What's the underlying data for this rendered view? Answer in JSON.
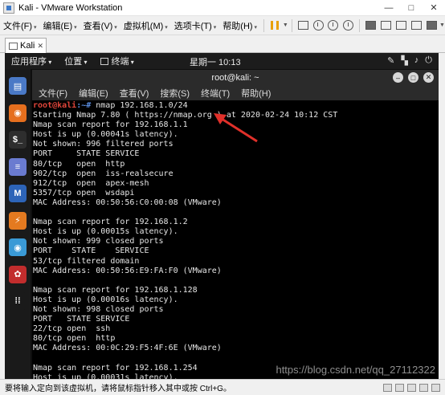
{
  "window": {
    "title": "Kali - VMware Workstation",
    "controls": [
      "—",
      "□",
      "✕"
    ]
  },
  "menubar": {
    "items": [
      "文件(F)",
      "编辑(E)",
      "查看(V)",
      "虚拟机(M)",
      "选项卡(T)",
      "帮助(H)"
    ]
  },
  "tab": {
    "label": "Kali",
    "close": "✕"
  },
  "gnome": {
    "apps_menu": "应用程序",
    "places_menu": "位置",
    "terminal_menu": "终端",
    "clock": "星期一 10:13",
    "tray": [
      "✎",
      "▚",
      "♪",
      "⏻"
    ]
  },
  "dock": {
    "icons": [
      {
        "name": "files-icon",
        "glyph": "▤",
        "color": "#4a79c6"
      },
      {
        "name": "firefox-icon",
        "glyph": "◉",
        "color": "#e66f1e"
      },
      {
        "name": "terminal-icon",
        "glyph": "$_",
        "color": "#2e2e2e"
      },
      {
        "name": "notes-icon",
        "glyph": "≡",
        "color": "#6a7bd0"
      },
      {
        "name": "metasploit-icon",
        "glyph": "M",
        "color": "#2d64b8"
      },
      {
        "name": "burpsuite-icon",
        "glyph": "⚡",
        "color": "#e47a20"
      },
      {
        "name": "eye-icon",
        "glyph": "◉",
        "color": "#3a9ad6"
      },
      {
        "name": "cherrytree-icon",
        "glyph": "✿",
        "color": "#c22d2d"
      },
      {
        "name": "show-apps-icon",
        "glyph": "⁞⁞",
        "color": "#1a1a1a"
      }
    ]
  },
  "terminal": {
    "title": "root@kali: ~",
    "menu": [
      "文件(F)",
      "编辑(E)",
      "查看(V)",
      "搜索(S)",
      "终端(T)",
      "帮助(H)"
    ],
    "prompt_user": "root@kali",
    "prompt_path": ":~#",
    "command": " nmap 192.168.1.0/24",
    "lines": [
      "Starting Nmap 7.80 ( https://nmap.org ) at 2020-02-24 10:12 CST",
      "Nmap scan report for 192.168.1.1",
      "Host is up (0.00041s latency).",
      "Not shown: 996 filtered ports",
      "PORT     STATE SERVICE",
      "80/tcp   open  http",
      "902/tcp  open  iss-realsecure",
      "912/tcp  open  apex-mesh",
      "5357/tcp open  wsdapi",
      "MAC Address: 00:50:56:C0:00:08 (VMware)",
      "",
      "Nmap scan report for 192.168.1.2",
      "Host is up (0.00015s latency).",
      "Not shown: 999 closed ports",
      "PORT    STATE    SERVICE",
      "53/tcp filtered domain",
      "MAC Address: 00:50:56:E9:FA:F0 (VMware)",
      "",
      "Nmap scan report for 192.168.1.128",
      "Host is up (0.00016s latency).",
      "Not shown: 998 closed ports",
      "PORT   STATE SERVICE",
      "22/tcp open  ssh",
      "80/tcp open  http",
      "MAC Address: 00:0C:29:F5:4F:6E (VMware)",
      "",
      "Nmap scan report for 192.168.1.254",
      "Host is up (0.00031s latency)."
    ],
    "watermark": "https://blog.csdn.net/qq_27112322"
  },
  "status": {
    "text": "要将输入定向到该虚拟机，请将鼠标指针移入其中或按 Ctrl+G。"
  },
  "colors": {
    "annotation_arrow": "#e0302a",
    "prompt_user": "#e0453a",
    "prompt_path": "#5a8de0"
  }
}
